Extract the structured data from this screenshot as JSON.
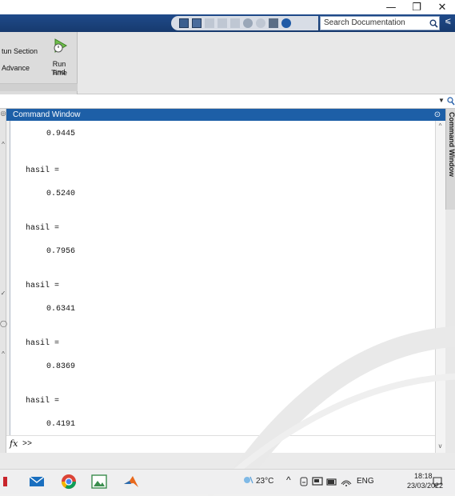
{
  "window": {
    "minimize_glyph": "—",
    "restore_glyph": "❐",
    "close_glyph": "✕"
  },
  "toolbar": {
    "search_placeholder": "Search Documentation",
    "search_icon": "search-icon",
    "pin_glyph": "⩽"
  },
  "ribbon": {
    "run_section_label": "tun Section",
    "advance_label": "Advance",
    "run_time_label_1": "Run and",
    "run_time_label_2": "Time"
  },
  "command_window": {
    "title": "Command Window",
    "dock_label": "Command Window",
    "prompt": ">>",
    "fx_label": "fx",
    "output": [
      {
        "value": "0.9445"
      },
      {
        "label": "hasil =",
        "value": "0.5240"
      },
      {
        "label": "hasil =",
        "value": "0.7956"
      },
      {
        "label": "hasil =",
        "value": "0.6341"
      },
      {
        "label": "hasil =",
        "value": "0.8369"
      },
      {
        "label": "hasil =",
        "value": "0.4191"
      }
    ]
  },
  "taskbar": {
    "temperature": "23°C",
    "language": "ENG",
    "time": "18:18",
    "date": "23/03/2022"
  },
  "colors": {
    "accent": "#1d5fa7",
    "titlebar_blue": "#1f4a8a"
  }
}
